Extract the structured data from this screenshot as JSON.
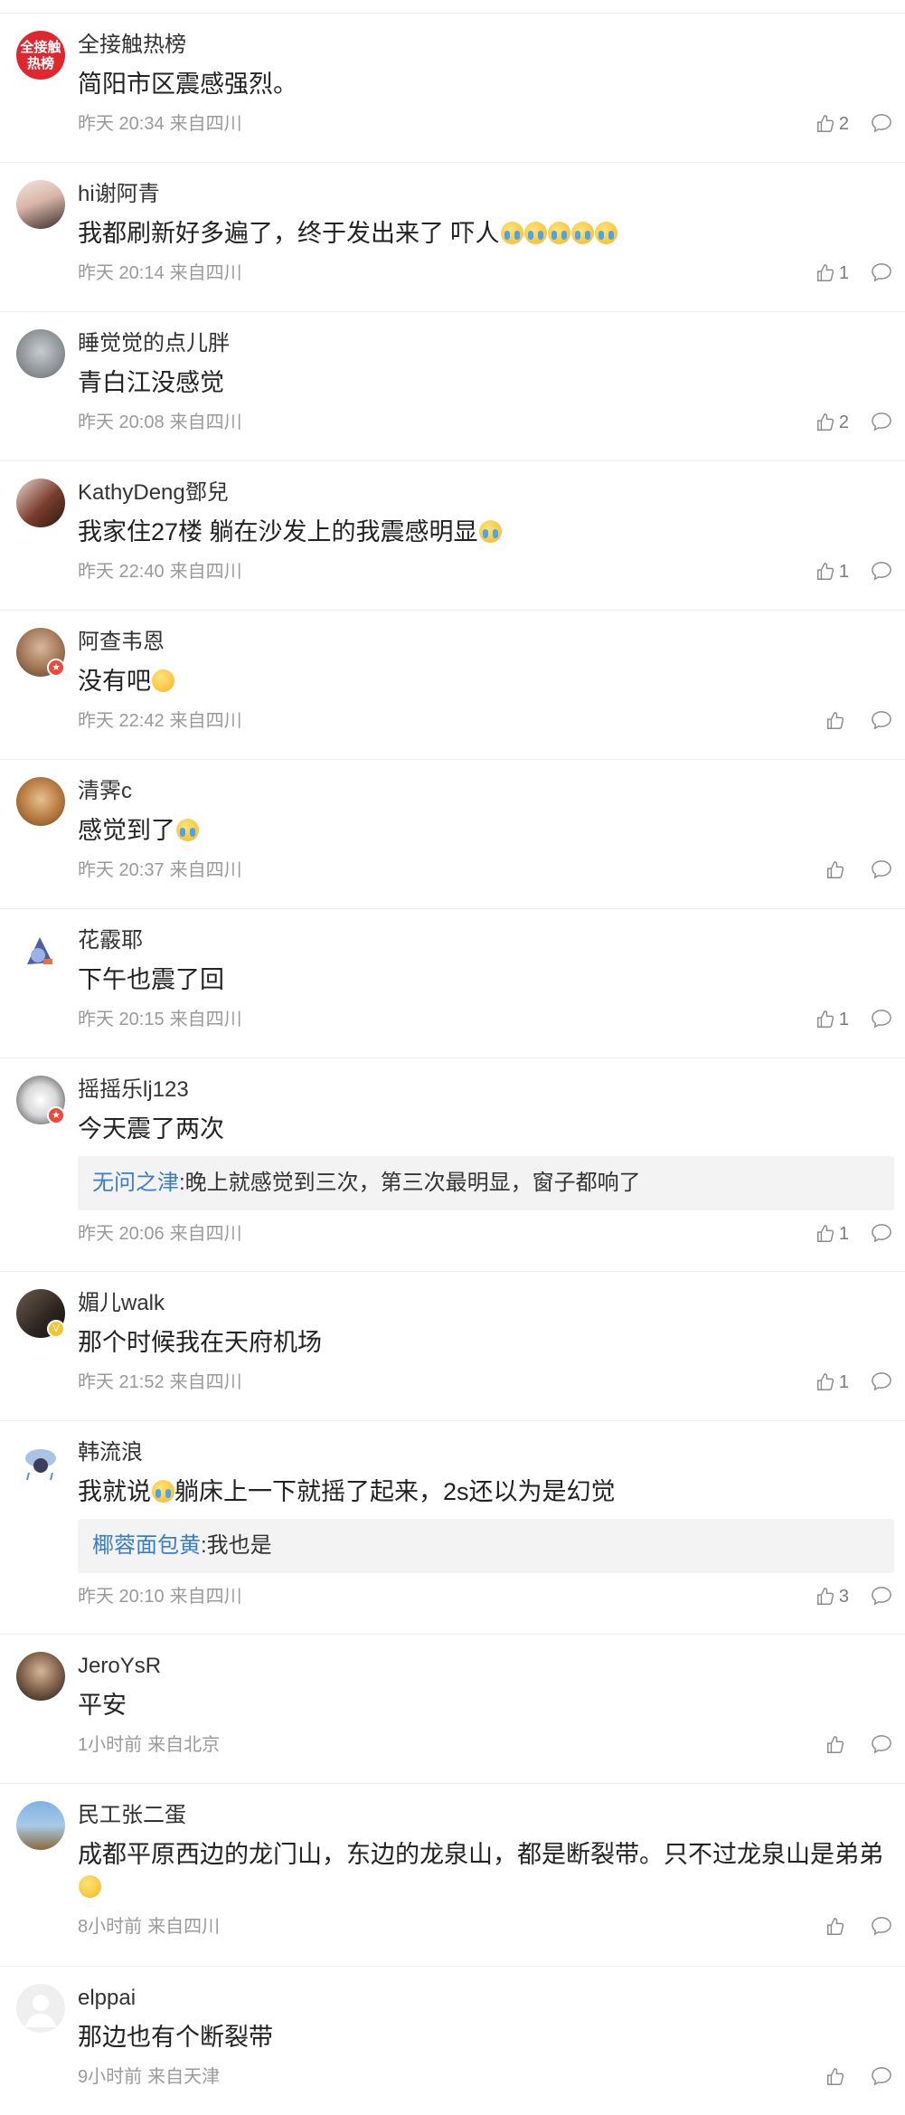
{
  "comments": [
    {
      "user": "全接触热榜",
      "text": "简阳市区震感强烈。",
      "time": "昨天 20:34",
      "location": "来自四川",
      "likes": "2"
    },
    {
      "user": "hi谢阿青",
      "text": "我都刷新好多遍了，终于发出来了 吓人",
      "time": "昨天 20:14",
      "location": "来自四川",
      "likes": "1"
    },
    {
      "user": "睡觉觉的点儿胖",
      "text": "青白江没感觉",
      "time": "昨天 20:08",
      "location": "来自四川",
      "likes": "2"
    },
    {
      "user": "KathyDeng鄧兒",
      "text": "我家住27楼 躺在沙发上的我震感明显",
      "time": "昨天 22:40",
      "location": "来自四川",
      "likes": "1"
    },
    {
      "user": "阿查韦恩",
      "text": "没有吧",
      "time": "昨天 22:42",
      "location": "来自四川",
      "likes": ""
    },
    {
      "user": "清霁c",
      "text": "感觉到了",
      "time": "昨天 20:37",
      "location": "来自四川",
      "likes": ""
    },
    {
      "user": "花霰耶",
      "text": "下午也震了回",
      "time": "昨天 20:15",
      "location": "来自四川",
      "likes": "1"
    },
    {
      "user": "摇摇乐lj123",
      "text": "今天震了两次",
      "reply_user": "无问之津",
      "reply_text": ":晚上就感觉到三次，第三次最明显，窗子都响了",
      "time": "昨天 20:06",
      "location": "来自四川",
      "likes": "1"
    },
    {
      "user": "媚儿walk",
      "text": "那个时候我在天府机场",
      "time": "昨天 21:52",
      "location": "来自四川",
      "likes": "1"
    },
    {
      "user": "韩流浪",
      "text_before": "我就说",
      "text_after": "躺床上一下就摇了起来，2s还以为是幻觉",
      "reply_user": "椰蓉面包黄",
      "reply_text": ":我也是",
      "time": "昨天 20:10",
      "location": "来自四川",
      "likes": "3"
    },
    {
      "user": "JeroYsR",
      "text": "平安",
      "time": "1小时前",
      "location": "来自北京",
      "likes": ""
    },
    {
      "user": "民工张二蛋",
      "text": "成都平原西边的龙门山，东边的龙泉山，都是断裂带。只不过龙泉山是弟弟",
      "time": "8小时前",
      "location": "来自四川",
      "likes": ""
    },
    {
      "user": "elppai",
      "text": "那边也有个断裂带",
      "time": "9小时前",
      "location": "来自天津",
      "likes": ""
    }
  ],
  "avatar0_text": "全接触热榜",
  "icons": {
    "like": "thumbs-up-icon",
    "comment": "comment-bubble-icon"
  },
  "colors": {
    "accent_link": "#3a7dc8",
    "meta": "#9a9a9a",
    "divider": "#eeeeee",
    "reply_bg": "#f3f3f3"
  }
}
